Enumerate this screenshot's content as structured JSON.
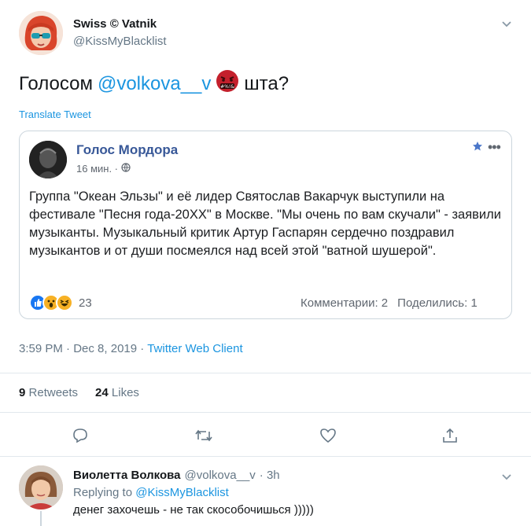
{
  "tweet": {
    "author_name": "Swiss © Vatnik",
    "author_handle": "@KissMyBlacklist",
    "text_before": "Голосом",
    "mention": "@volkova__v",
    "text_after": "шта?",
    "emoji": "angry-face-with-symbols-icon",
    "translate_label": "Translate Tweet",
    "time": "3:59 PM",
    "date": "Dec 8, 2019",
    "separator": "·",
    "client": "Twitter Web Client",
    "retweets_count": "9",
    "retweets_label": "Retweets",
    "likes_count": "24",
    "likes_label": "Likes"
  },
  "quoted_post": {
    "page_name": "Голос Мордора",
    "time": "16 мин. ·",
    "body": "Группа \"Океан Эльзы\" и её лидер Святослав Вакарчук выступили на фестивале \"Песня года-20XX\" в Москве. \"Мы очень по вам скучали\" - заявили музыканты. Музыкальный критик Артур Гаспарян сердечно поздравил музыкантов и от души посмеялся над всей этой \"ватной шушерой\".",
    "reactions_count": "23",
    "comments": "Комментарии: 2",
    "shares": "Поделились: 1",
    "reactions": [
      "like-icon",
      "wow-icon",
      "haha-icon"
    ]
  },
  "actions": [
    "reply-icon",
    "retweet-icon",
    "like-icon",
    "share-icon"
  ],
  "reply": {
    "author_name": "Виолетта Волкова",
    "author_handle": "@volkova__v",
    "time": "· 3h",
    "replying_label": "Replying to",
    "replying_to": "@KissMyBlacklist",
    "text": "денег захочешь - не так скособочишься )))))"
  },
  "colors": {
    "twitter_blue": "#1b95e0",
    "facebook_blue": "#385898",
    "secondary": "#657786"
  }
}
